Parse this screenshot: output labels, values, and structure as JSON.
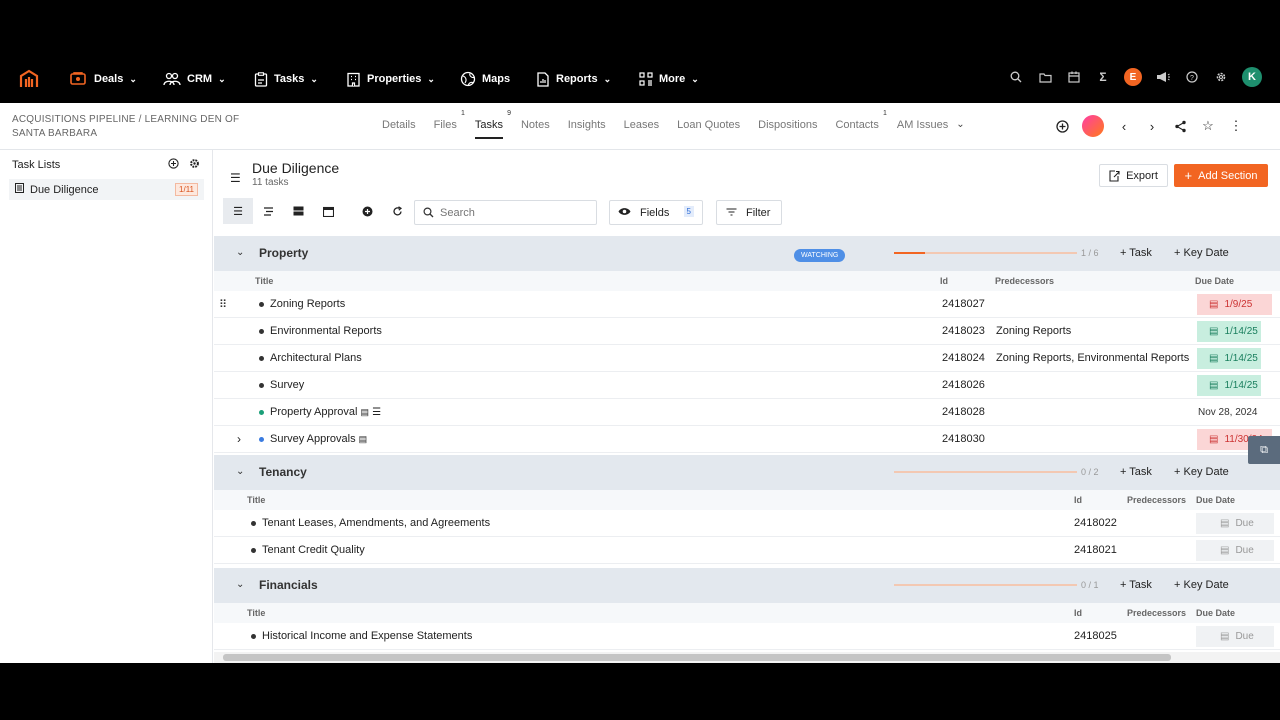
{
  "nav": {
    "items": [
      {
        "label": "Deals",
        "icon": "deals-icon",
        "chevron": true
      },
      {
        "label": "CRM",
        "icon": "people-icon",
        "chevron": true
      },
      {
        "label": "Tasks",
        "icon": "clipboard-icon",
        "chevron": true
      },
      {
        "label": "Properties",
        "icon": "building-icon",
        "chevron": true
      },
      {
        "label": "Maps",
        "icon": "globe-icon",
        "chevron": false
      },
      {
        "label": "Reports",
        "icon": "report-icon",
        "chevron": true
      },
      {
        "label": "More",
        "icon": "grid-icon",
        "chevron": true
      }
    ],
    "user_initial_e": "E",
    "user_initial_k": "K",
    "accent": "#f26522"
  },
  "subheader": {
    "breadcrumb": "ACQUISITIONS PIPELINE / LEARNING DEN OF SANTA BARBARA",
    "tabs": [
      {
        "label": "Details",
        "count": ""
      },
      {
        "label": "Files",
        "count": "1"
      },
      {
        "label": "Tasks",
        "count": "9",
        "active": true
      },
      {
        "label": "Notes",
        "count": ""
      },
      {
        "label": "Insights",
        "count": ""
      },
      {
        "label": "Leases",
        "count": ""
      },
      {
        "label": "Loan Quotes",
        "count": ""
      },
      {
        "label": "Dispositions",
        "count": ""
      },
      {
        "label": "Contacts",
        "count": "1"
      },
      {
        "label": "AM Issues",
        "count": ""
      }
    ]
  },
  "sidebar": {
    "title": "Task Lists",
    "items": [
      {
        "label": "Due Diligence",
        "count": "1/11"
      }
    ]
  },
  "main": {
    "title": "Due Diligence",
    "subtitle": "11 tasks",
    "export_label": "Export",
    "add_section_label": "Add Section",
    "search_placeholder": "Search",
    "fields_label": "Fields",
    "fields_count": "5",
    "filter_label": "Filter"
  },
  "sections": [
    {
      "name": "Property",
      "badge": "WATCHING",
      "progress_text": "1 / 6",
      "progress": 0.1667,
      "task_label": "Task",
      "key_date_label": "Key Date",
      "columns": [
        "Title",
        "Id",
        "Predecessors",
        "Due Date"
      ],
      "rows": [
        {
          "title": "Zoning Reports",
          "id": "2418027",
          "pred": "",
          "due": "1/9/25",
          "due_style": "red",
          "dot": "#333"
        },
        {
          "title": "Environmental Reports",
          "id": "2418023",
          "pred": "Zoning Reports",
          "due": "1/14/25",
          "due_style": "green",
          "dot": "#333"
        },
        {
          "title": "Architectural Plans",
          "id": "2418024",
          "pred": "Zoning Reports, Environmental Reports",
          "due": "1/14/25",
          "due_style": "green",
          "dot": "#333"
        },
        {
          "title": "Survey",
          "id": "2418026",
          "pred": "",
          "due": "1/14/25",
          "due_style": "green",
          "dot": "#333"
        },
        {
          "title": "Property Approval",
          "id": "2418028",
          "pred": "",
          "due": "Nov 28, 2024",
          "due_style": "plain",
          "dot": "#1a9f78"
        },
        {
          "title": "Survey Approvals",
          "id": "2418030",
          "pred": "",
          "due": "11/30/24",
          "due_style": "red",
          "dot": "#3a7be0"
        }
      ]
    },
    {
      "name": "Tenancy",
      "progress_text": "0 / 2",
      "progress": 0,
      "task_label": "Task",
      "key_date_label": "Key Date",
      "columns": [
        "Title",
        "Id",
        "Predecessors",
        "Due Date"
      ],
      "rows": [
        {
          "title": "Tenant Leases, Amendments, and Agreements",
          "id": "2418022",
          "pred": "",
          "due": "Due",
          "due_style": "grey"
        },
        {
          "title": "Tenant Credit Quality",
          "id": "2418021",
          "pred": "",
          "due": "Due",
          "due_style": "grey"
        }
      ]
    },
    {
      "name": "Financials",
      "progress_text": "0 / 1",
      "progress": 0,
      "task_label": "Task",
      "key_date_label": "Key Date",
      "columns": [
        "Title",
        "Id",
        "Predecessors",
        "Due Date"
      ],
      "rows": [
        {
          "title": "Historical Income and Expense Statements",
          "id": "2418025",
          "pred": "",
          "due": "Due",
          "due_style": "grey"
        }
      ]
    }
  ]
}
